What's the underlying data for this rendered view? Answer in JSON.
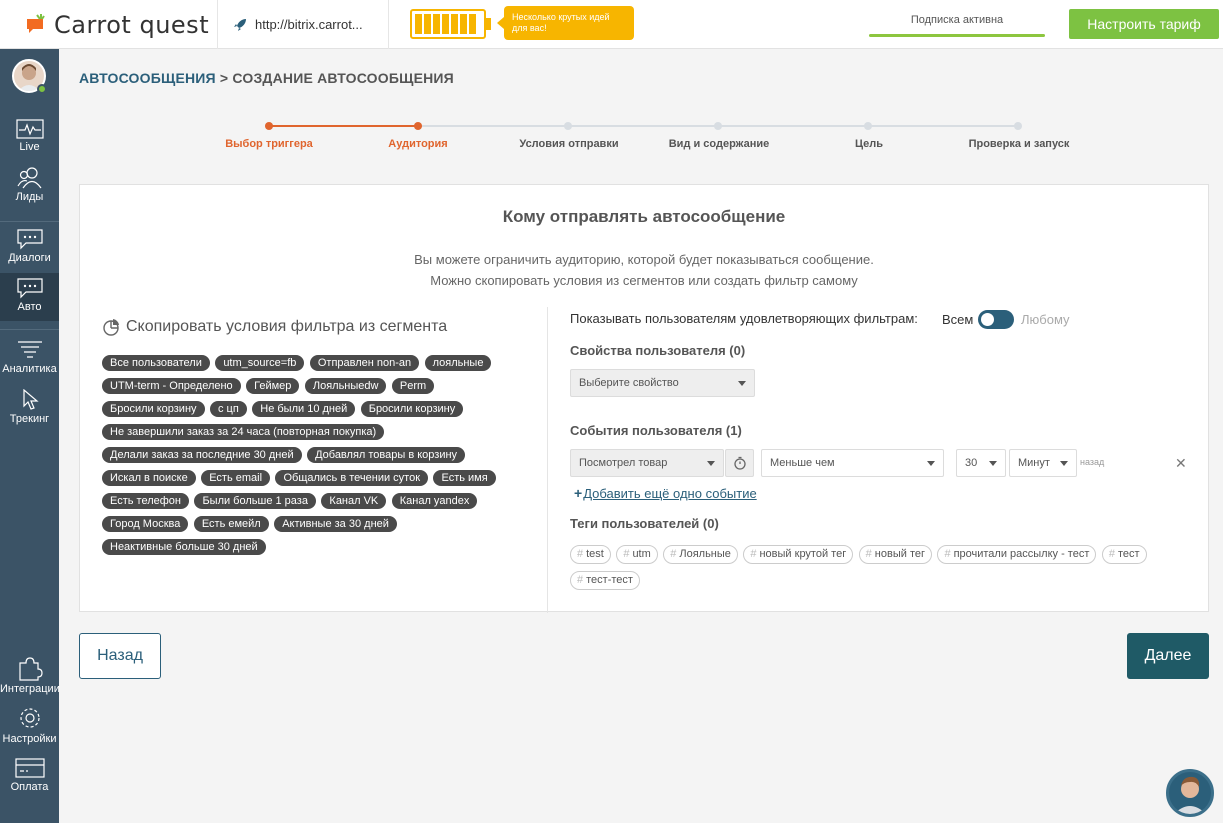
{
  "header": {
    "logo_text": "Carrot quest",
    "site_url": "http://bitrix.carrot...",
    "idea_banner": "Несколько крутых идей для вас!",
    "subscription_status": "Подписка активна",
    "tariff_button": "Настроить тариф",
    "colors": {
      "accent_green": "#7dc242",
      "idea_orange": "#f7b500"
    }
  },
  "sidebar": {
    "items": [
      {
        "label": "Live",
        "icon": "pulse-icon"
      },
      {
        "label": "Лиды",
        "icon": "users-icon"
      },
      {
        "label": "Диалоги",
        "icon": "chat-icon"
      },
      {
        "label": "Авто",
        "icon": "auto-message-icon",
        "active": true
      },
      {
        "label": "Аналитика",
        "icon": "funnel-icon"
      },
      {
        "label": "Трекинг",
        "icon": "cursor-icon"
      },
      {
        "label": "Интеграции",
        "icon": "puzzle-icon"
      },
      {
        "label": "Настройки",
        "icon": "gear-icon"
      },
      {
        "label": "Оплата",
        "icon": "card-icon"
      }
    ]
  },
  "breadcrumb": {
    "parent": "АВТОСООБЩЕНИЯ",
    "separator": ">",
    "current": "СОЗДАНИЕ АВТОСООБЩЕНИЯ"
  },
  "steps": [
    {
      "label": "Выбор триггера",
      "done": true
    },
    {
      "label": "Аудитория",
      "done": true
    },
    {
      "label": "Условия отправки",
      "done": false
    },
    {
      "label": "Вид и содержание",
      "done": false
    },
    {
      "label": "Цель",
      "done": false
    },
    {
      "label": "Проверка и запуск",
      "done": false
    }
  ],
  "main": {
    "title": "Кому отправлять автосообщение",
    "desc_line1": "Вы можете ограничить аудиторию, которой будет показываться сообщение.",
    "desc_line2": "Можно скопировать условия из сегментов или создать фильтр самому",
    "segments_title": "Скопировать условия фильтра из сегмента",
    "segments": [
      "Все пользователи",
      "utm_source=fb",
      "Отправлен non-an",
      "лояльные",
      "UTM-term - Определено",
      "Геймер",
      "Лояльныеdw",
      "Perm",
      "Бросили корзину",
      "с цп",
      "Не были 10 дней",
      "Бросили корзину",
      "Не завершили заказ за 24 часа (повторная покупка)",
      "Делали заказ за последние 30 дней",
      "Добавлял товары в корзину",
      "Искал в поиске",
      "Есть email",
      "Общались в течении суток",
      "Есть имя",
      "Есть телефон",
      "Были больше 1 раза",
      "Канал VK",
      "Канал yandex",
      "Город Москва",
      "Есть емейл",
      "Активные за 30 дней",
      "Неактивные больше 30 дней"
    ],
    "filter": {
      "show_label": "Показывать пользователям удовлетворяющих фильтрам:",
      "toggle_all": "Всем",
      "toggle_any": "Любому",
      "properties_title": "Свойства пользователя (0)",
      "property_placeholder": "Выберите свойство",
      "events_title": "События пользователя (1)",
      "event": {
        "name": "Посмотрел товар",
        "condition": "Меньше чем",
        "amount": "30",
        "unit": "Минут",
        "ago": "назад"
      },
      "add_event": "Добавить ещё одно событие",
      "tags_title": "Теги пользователей (0)",
      "tags": [
        "test",
        "utm",
        "Лояльные",
        "новый крутой тег",
        "новый тег",
        "прочитали рассылку - тест",
        "тест",
        "тест-тест"
      ]
    }
  },
  "footer": {
    "back_button": "Назад",
    "next_button": "Далее"
  }
}
